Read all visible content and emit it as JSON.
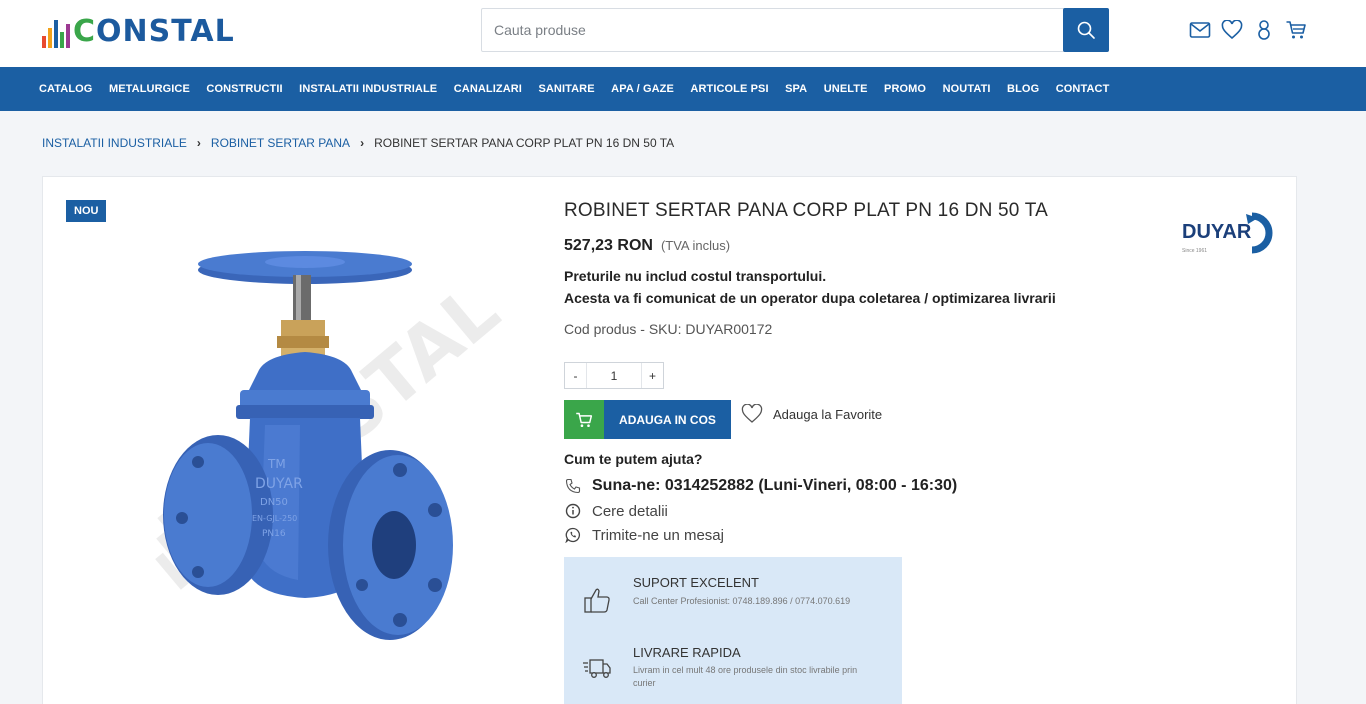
{
  "header": {
    "logo_text": "CONSTAL",
    "search": {
      "placeholder": "Cauta produse",
      "value": ""
    }
  },
  "nav": {
    "items": [
      "CATALOG",
      "METALURGICE",
      "CONSTRUCTII",
      "INSTALATII INDUSTRIALE",
      "CANALIZARI",
      "SANITARE",
      "APA / GAZE",
      "ARTICOLE PSI",
      "SPA",
      "UNELTE",
      "PROMO",
      "NOUTATI",
      "BLOG",
      "CONTACT"
    ]
  },
  "breadcrumb": {
    "items": [
      "INSTALATII INDUSTRIALE",
      "ROBINET SERTAR PANA"
    ],
    "separator": "›",
    "current": "ROBINET SERTAR PANA CORP PLAT PN 16 DN 50 TA"
  },
  "product": {
    "badge": "NOU",
    "title": "ROBINET SERTAR PANA CORP PLAT PN 16 DN 50 TA",
    "brand": "DUYAR",
    "brand_subtitle": "Since 1961",
    "price": "527,23 RON",
    "vat_note": "(TVA inclus)",
    "shipping_note_1": "Preturile nu includ costul transportului.",
    "shipping_note_2": "Acesta va fi comunicat de un operator dupa coletarea / optimizarea livrarii",
    "sku": "Cod produs - SKU: DUYAR00172",
    "quantity": "1",
    "qty_minus": "-",
    "qty_plus": "+",
    "add_to_cart": "ADAUGA IN COS",
    "add_to_favorites": "Adauga la Favorite",
    "image_watermark": "CONSTAL",
    "valve_marking": [
      "TM",
      "DUYAR",
      "DN50",
      "EN-GJL-250",
      "PN16"
    ]
  },
  "help": {
    "title": "Cum te putem ajuta?",
    "phone": "Suna-ne: 0314252882 (Luni-Vineri, 08:00 - 16:30)",
    "details": "Cere detalii",
    "message": "Trimite-ne un mesaj"
  },
  "support": [
    {
      "title": "SUPORT EXCELENT",
      "desc": "Call Center Profesionist: 0748.189.896 / 0774.070.619"
    },
    {
      "title": "LIVRARE RAPIDA",
      "desc": "Livram in cel mult 48 ore produsele din stoc livrabile prin curier"
    }
  ],
  "colors": {
    "brand_blue": "#1b5fa3",
    "brand_green": "#3aa64a",
    "valve_blue": "#3f6fc7",
    "support_bg": "#d9e8f7"
  }
}
